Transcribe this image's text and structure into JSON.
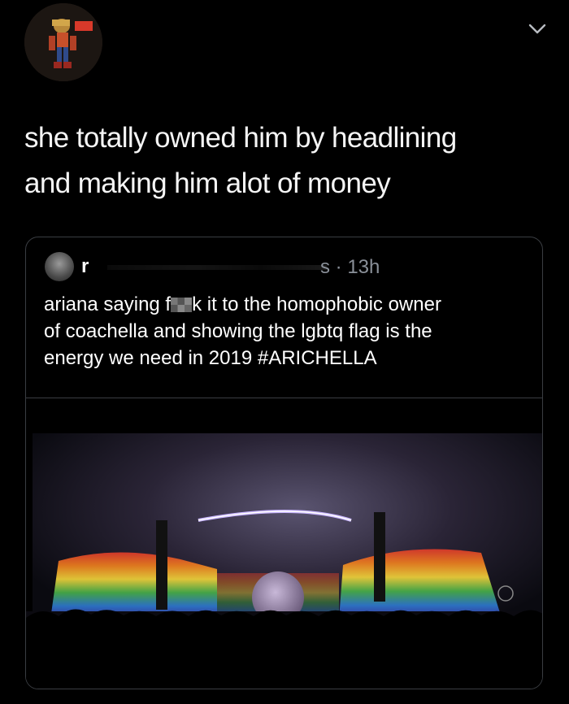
{
  "tweet": {
    "text_line1": "she totally owned him by headlining",
    "text_line2": "and making him alot of money"
  },
  "quoted": {
    "name": "r",
    "meta": "s · 13h",
    "text_line1_before": "ariana saying f",
    "text_line1_after": "k it to the homophobic owner",
    "text_line2": "of coachella and showing the lgbtq flag is the",
    "text_line3": "energy we need in 2019 #ARICHELLA"
  },
  "icons": {
    "menu": "chevron-down-icon"
  },
  "colors": {
    "background": "#000000",
    "border": "#3a3d42",
    "secondary_text": "#8a9099"
  }
}
